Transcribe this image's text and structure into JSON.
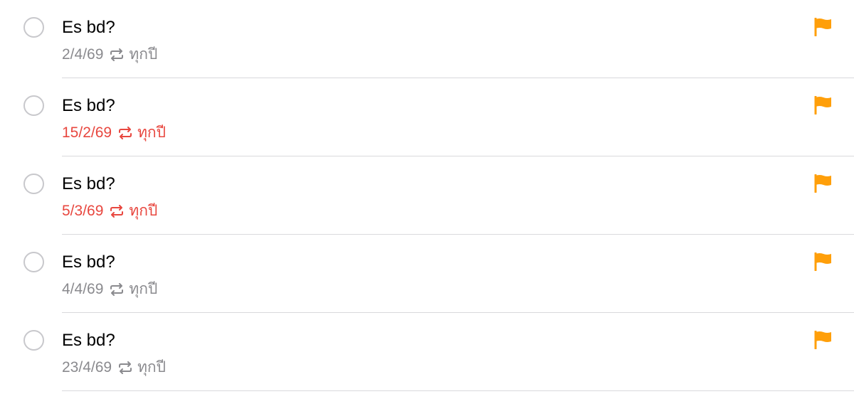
{
  "colors": {
    "flag": "#ff9f0a",
    "overdue": "#e8473f",
    "secondary": "#8a8a8e",
    "divider": "#d9d9dc"
  },
  "reminders": [
    {
      "title": "Es bd?",
      "date": "2/4/69",
      "repeat": "ทุกปี",
      "overdue": false,
      "flag_icon": "flag-icon",
      "repeat_icon": "repeat-icon"
    },
    {
      "title": "Es bd?",
      "date": "15/2/69",
      "repeat": "ทุกปี",
      "overdue": true,
      "flag_icon": "flag-icon",
      "repeat_icon": "repeat-icon"
    },
    {
      "title": "Es bd?",
      "date": "5/3/69",
      "repeat": "ทุกปี",
      "overdue": true,
      "flag_icon": "flag-icon",
      "repeat_icon": "repeat-icon"
    },
    {
      "title": "Es bd?",
      "date": "4/4/69",
      "repeat": "ทุกปี",
      "overdue": false,
      "flag_icon": "flag-icon",
      "repeat_icon": "repeat-icon"
    },
    {
      "title": "Es bd?",
      "date": "23/4/69",
      "repeat": "ทุกปี",
      "overdue": false,
      "flag_icon": "flag-icon",
      "repeat_icon": "repeat-icon"
    }
  ]
}
